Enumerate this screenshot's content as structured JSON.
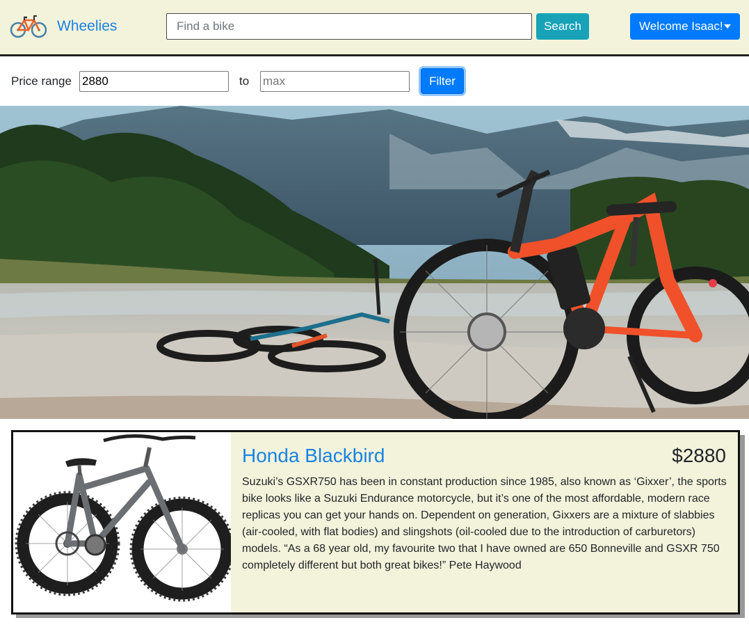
{
  "brand": {
    "name": "Wheelies",
    "icon": "bicycle-icon"
  },
  "search": {
    "placeholder": "Find a bike",
    "value": "",
    "button_label": "Search"
  },
  "user_menu": {
    "label": "Welcome Isaac!"
  },
  "filter": {
    "label": "Price range",
    "min_value": "2880",
    "min_placeholder": "",
    "to_label": "to",
    "max_value": "",
    "max_placeholder": "max",
    "button_label": "Filter"
  },
  "hero": {
    "image": "hero-mountain-bikes"
  },
  "product": {
    "title": "Honda Blackbird",
    "price": "$2880",
    "description": "Suzuki’s GSXR750 has been in constant production since 1985, also known as ‘Gixxer’, the sports bike looks like a Suzuki Endurance motorcycle, but it’s one of the most affordable, modern race replicas you can get your hands on. Dependent on generation, Gixxers are a mixture of slabbies (air-cooled, with flat bodies) and slingshots (oil-cooled due to the introduction of carburetors) models. “As a 68 year old, my favourite two that I have owned are 650 Bonneville and GSXR 750 completely different but both great bikes!” Pete Haywood",
    "image": "fat-tire-bike-image"
  },
  "colors": {
    "navbar_bg": "#f3f3db",
    "brand_link": "#1a82e2",
    "search_button": "#17a2b8",
    "primary_button": "#007bff",
    "card_bg": "#f3f3db"
  }
}
